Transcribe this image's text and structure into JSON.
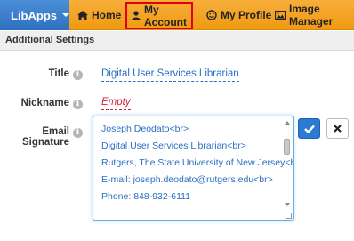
{
  "navbar": {
    "brand_label": "LibApps",
    "items": [
      {
        "label": "Home",
        "icon": "home-icon"
      },
      {
        "label": "My Account",
        "icon": "user-icon"
      },
      {
        "label": "My Profile",
        "icon": "smile-icon"
      },
      {
        "label": "Image Manager",
        "icon": "image-icon"
      }
    ]
  },
  "section": {
    "title": "Additional Settings"
  },
  "fields": {
    "title": {
      "label": "Title",
      "value": "Digital User Services Librarian"
    },
    "nickname": {
      "label": "Nickname",
      "value": "Empty"
    },
    "email_signature": {
      "label": "Email Signature",
      "lines": [
        "Joseph Deodato<br>",
        "Digital User Services Librarian<br>",
        "Rutgers, The State University of New Jersey<br>",
        "E-mail: joseph.deodato@rutgers.edu<br>",
        "Phone:  848-932-6111"
      ]
    }
  },
  "colors": {
    "brand": "#2f6fc0",
    "navbar": "#f5a623",
    "link": "#2a6ec2",
    "empty": "#d0243a",
    "highlight_border": "#e3000f"
  }
}
